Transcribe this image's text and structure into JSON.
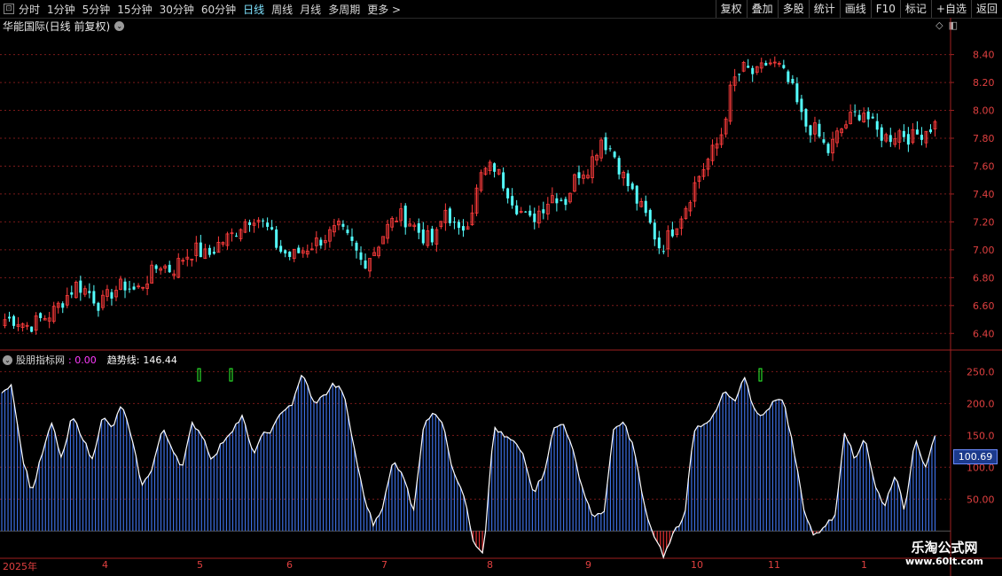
{
  "toolbar": {
    "left_items": [
      "分时",
      "1分钟",
      "5分钟",
      "15分钟",
      "30分钟",
      "60分钟",
      "日线",
      "周线",
      "月线",
      "多周期",
      "更多 >"
    ],
    "active_index": 6,
    "right_items": [
      "复权",
      "叠加",
      "多股",
      "统计",
      "画线",
      "F10",
      "标记",
      "+自选",
      "返回"
    ]
  },
  "chart_title": "华能国际(日线 前复权)",
  "price_axis": [
    "8.40",
    "8.20",
    "8.00",
    "7.80",
    "7.60",
    "7.40",
    "7.20",
    "7.00",
    "6.80",
    "6.60",
    "6.40"
  ],
  "indicator": {
    "name": "股朋指标网",
    "value1": ": 0.00",
    "label2": "趋势线:",
    "value2": "146.44",
    "axis": [
      "250.0",
      "200.0",
      "150.0",
      "100.0",
      "50.00"
    ],
    "current_tag": "100.69"
  },
  "date_labels": [
    "2025年",
    "4",
    "5",
    "6",
    "7",
    "8",
    "9",
    "10",
    "11",
    "1"
  ],
  "watermark": {
    "line1": "乐淘公式网",
    "line2": "www.60lt.com"
  },
  "colors": {
    "up": "#ff3c3c",
    "down": "#54ffff",
    "bar": "#3c6ee0",
    "neg": "#e03030",
    "trend": "#ffffff",
    "grid": "#7a1a1a"
  },
  "chart_data": {
    "type": "candlestick",
    "price_ylim": [
      6.3,
      8.55
    ],
    "closes_anchor": [
      6.5,
      6.5,
      6.45,
      6.5,
      6.55,
      6.65,
      6.75,
      6.7,
      6.6,
      6.7,
      6.75,
      6.7,
      6.8,
      6.9,
      6.85,
      6.95,
      7.0,
      6.95,
      7.05,
      7.1,
      7.2,
      7.25,
      7.15,
      7.0,
      6.95,
      7.0,
      7.05,
      7.1,
      7.15,
      7.05,
      6.9,
      7.0,
      7.15,
      7.25,
      7.2,
      7.1,
      7.05,
      7.3,
      7.1,
      7.25,
      7.55,
      7.6,
      7.45,
      7.3,
      7.2,
      7.3,
      7.4,
      7.35,
      7.55,
      7.6,
      7.8,
      7.7,
      7.5,
      7.35,
      7.2,
      7.0,
      7.15,
      7.3,
      7.5,
      7.65,
      7.8,
      8.2,
      8.3,
      8.25,
      8.35,
      8.3,
      8.15,
      7.9,
      7.85,
      7.7,
      7.85,
      7.95,
      8.0,
      7.85,
      7.8,
      7.85,
      7.8,
      7.85,
      7.9
    ],
    "indicator_ylim": [
      -40,
      270
    ],
    "trend_anchor": [
      220,
      230,
      120,
      60,
      120,
      170,
      110,
      180,
      150,
      110,
      180,
      160,
      200,
      140,
      70,
      100,
      160,
      130,
      100,
      170,
      150,
      110,
      140,
      160,
      180,
      120,
      150,
      160,
      190,
      200,
      250,
      200,
      210,
      230,
      220,
      140,
      60,
      10,
      40,
      110,
      90,
      30,
      160,
      190,
      170,
      90,
      60,
      -20,
      -40,
      160,
      150,
      140,
      120,
      60,
      90,
      160,
      170,
      120,
      60,
      20,
      30,
      160,
      170,
      130,
      40,
      -10,
      -40,
      0,
      20,
      160,
      170,
      180,
      220,
      200,
      240,
      190,
      180,
      210,
      200,
      120,
      30,
      -10,
      10,
      20,
      160,
      110,
      150,
      70,
      40,
      90,
      30,
      150,
      100,
      146
    ]
  }
}
